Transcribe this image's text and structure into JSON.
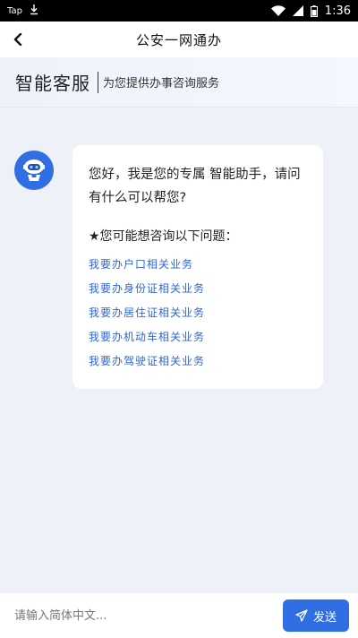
{
  "status_bar": {
    "app_label": "Tap",
    "time": "1:36"
  },
  "title_bar": {
    "title": "公安一网通办"
  },
  "banner": {
    "title": "智能客服",
    "subtitle": "为您提供办事咨询服务"
  },
  "chat": {
    "greeting": "您好，我是您的专属 智能助手，请问有什么可以帮您?",
    "prompt": "★您可能想咨询以下问题：",
    "links": [
      "我要办户口相关业务",
      "我要办身份证相关业务",
      "我要办居住证相关业务",
      "我要办机动车相关业务",
      "我要办驾驶证相关业务"
    ]
  },
  "input": {
    "placeholder": "请输入简体中文...",
    "value": "",
    "send_label": "发送"
  },
  "colors": {
    "accent": "#2f6fe3",
    "link": "#2f66d6",
    "background": "#eef1f8"
  }
}
